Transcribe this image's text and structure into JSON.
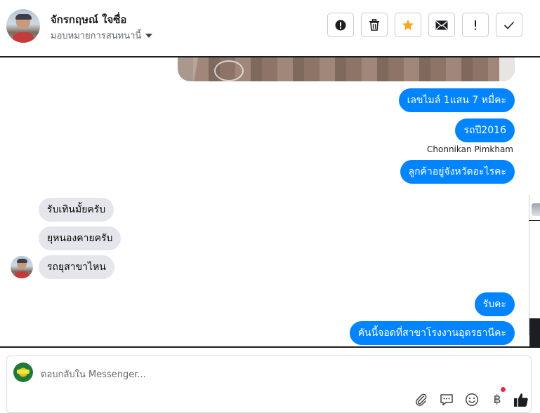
{
  "header": {
    "contact_name": "จักรกฤษณ์ ใจซื่อ",
    "assign_label": "มอบหมายการสนทนานี้",
    "actions": [
      {
        "icon": "alert-circle-icon"
      },
      {
        "icon": "trash-icon"
      },
      {
        "icon": "star-icon"
      },
      {
        "icon": "envelope-icon"
      },
      {
        "icon": "exclamation-icon"
      },
      {
        "icon": "checkmark-icon"
      }
    ],
    "star_color": "#f5a623"
  },
  "conversation": {
    "messages": [
      {
        "text": "เลขไมล์ 1แสน 7 หมื่คะ",
        "direction": "outgoing"
      },
      {
        "text": "รถปี2016",
        "direction": "outgoing"
      },
      {
        "text": "ลูกค้าอยู่จังหวัดอะไรคะ",
        "direction": "outgoing"
      },
      {
        "text": "รับเทินมั้ยครับ",
        "direction": "incoming"
      },
      {
        "text": "ยุหนองคายครับ",
        "direction": "incoming"
      },
      {
        "text": "รถยุสาขาไหน",
        "direction": "incoming"
      },
      {
        "text": "รับคะ",
        "direction": "outgoing"
      },
      {
        "text": "คันนี้จอดที่สาขาโรงงานอุดรธานีคะ",
        "direction": "outgoing"
      }
    ],
    "sender_label": "Chonnikan Pimkham",
    "outgoing_color": "#0084ff",
    "incoming_color": "#e4e6eb"
  },
  "composer": {
    "placeholder": "ตอบกลับใน Messenger...",
    "tools": [
      {
        "icon": "paperclip-icon"
      },
      {
        "icon": "saved-replies-icon"
      },
      {
        "icon": "emoji-icon"
      },
      {
        "icon": "baht-payment-icon",
        "glyph": "฿"
      },
      {
        "icon": "thumbs-up-icon"
      }
    ]
  }
}
